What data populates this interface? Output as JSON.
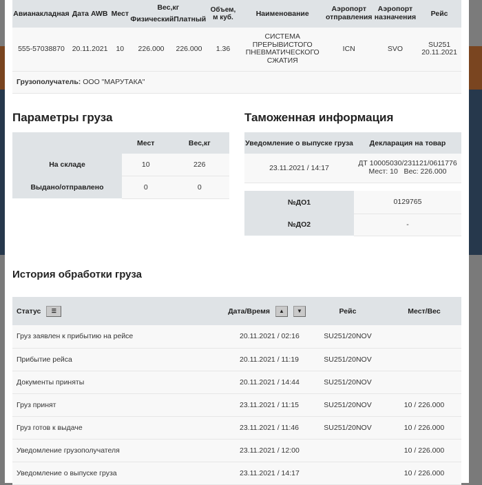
{
  "awb_table": {
    "headers": [
      "Авианакладная",
      "Дата AWB",
      "Мест",
      "Вес,кг",
      "Физический",
      "Платный",
      "Объем,\nм куб.",
      "Наименование",
      "Аэропорт\nотправления",
      "Аэропорт\nназначения",
      "Рейс"
    ],
    "row": [
      "555-57038870",
      "20.11.2021",
      "10",
      "226.000",
      "226.000",
      "1.36",
      "СИСТЕМА ПРЕРЫВИСТОГО ПНЕВМАТИЧЕСКОГО СЖАТИЯ",
      "ICN",
      "SVO",
      "SU251 20.11.2021"
    ],
    "consignee_label": "Грузополучатель:",
    "consignee_value": "ООО \"МАРУТАКА\""
  },
  "cargo_params": {
    "title": "Параметры груза",
    "headers": [
      "Мест",
      "Вес,кг"
    ],
    "rows": [
      {
        "label": "На складе",
        "places": "10",
        "weight": "226"
      },
      {
        "label": "Выдано/отправлено",
        "places": "0",
        "weight": "0"
      }
    ]
  },
  "customs": {
    "title": "Таможенная информация",
    "headers": [
      "Уведомление о выпуске груза",
      "Декларация на товар"
    ],
    "release": "23.11.2021 / 14:17",
    "declaration": "ДТ 10005030/231121/0611776",
    "declaration_details": "Мест: 10   Вес: 226.000",
    "docs": [
      {
        "label": "№ДО1",
        "value": "0129765"
      },
      {
        "label": "№ДО2",
        "value": "-"
      }
    ]
  },
  "history": {
    "title": "История обработки груза",
    "headers": [
      "Статус",
      "Дата/Время",
      "Рейс",
      "Мест/Вес"
    ],
    "rows": [
      [
        "Груз заявлен к прибытию на рейсе",
        "20.11.2021 / 02:16",
        "SU251/20NOV",
        ""
      ],
      [
        "Прибытие рейса",
        "20.11.2021 / 11:19",
        "SU251/20NOV",
        ""
      ],
      [
        "Документы приняты",
        "20.11.2021 / 14:44",
        "SU251/20NOV",
        ""
      ],
      [
        "Груз принят",
        "23.11.2021 / 11:15",
        "SU251/20NOV",
        "10 / 226.000"
      ],
      [
        "Груз готов к выдаче",
        "23.11.2021 / 11:46",
        "SU251/20NOV",
        "10 / 226.000"
      ],
      [
        "Уведомление грузополучателя",
        "23.11.2021 / 12:00",
        "",
        "10 / 226.000"
      ],
      [
        "Уведомление о выпуске груза",
        "23.11.2021 / 14:17",
        "",
        "10 / 226.000"
      ]
    ]
  }
}
